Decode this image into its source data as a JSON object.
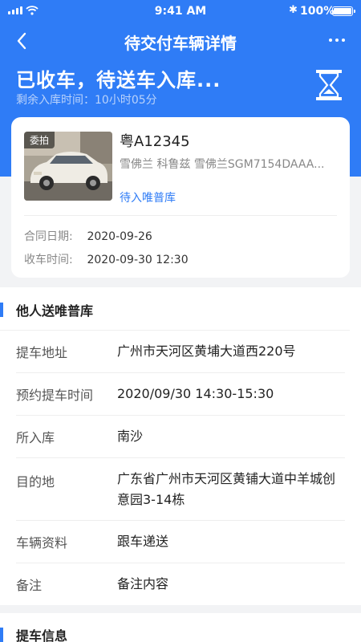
{
  "status_bar": {
    "time": "9:41 AM",
    "battery": "100%",
    "icons": [
      "signal-icon",
      "wifi-icon",
      "bluetooth-icon",
      "battery-icon"
    ]
  },
  "nav": {
    "title": "待交付车辆详情",
    "back_icon": "chevron-left-icon",
    "more_icon": "more-dots-icon"
  },
  "state": {
    "title": "已收车，待送车入库...",
    "remaining": "剩余入库时间：10小时05分",
    "icon": "hourglass-icon"
  },
  "car": {
    "tag": "委拍",
    "plate": "粤A12345",
    "model": "雪佛兰 科鲁兹 雪佛兰SGM7154DAAA...",
    "status": "待入唯普库",
    "contract_label": "合同日期:",
    "contract_date": "2020-09-26",
    "receive_label": "收车时间:",
    "receive_time": "2020-09-30 12:30"
  },
  "delivery": {
    "title": "他人送唯普库",
    "rows": [
      {
        "label": "提车地址",
        "value": "广州市天河区黄埔大道西220号"
      },
      {
        "label": "预约提车时间",
        "value": "2020/09/30 14:30-15:30"
      },
      {
        "label": "所入库",
        "value": "南沙"
      },
      {
        "label": "目的地",
        "value": "广东省广州市天河区黄铺大道中羊城创意园3-14栋"
      },
      {
        "label": "车辆资料",
        "value": "跟车递送"
      },
      {
        "label": "备注",
        "value": "备注内容"
      }
    ]
  },
  "pickup": {
    "title": "提车信息"
  },
  "colors": {
    "primary": "#2f7cf6",
    "background": "#f2f3f5"
  }
}
